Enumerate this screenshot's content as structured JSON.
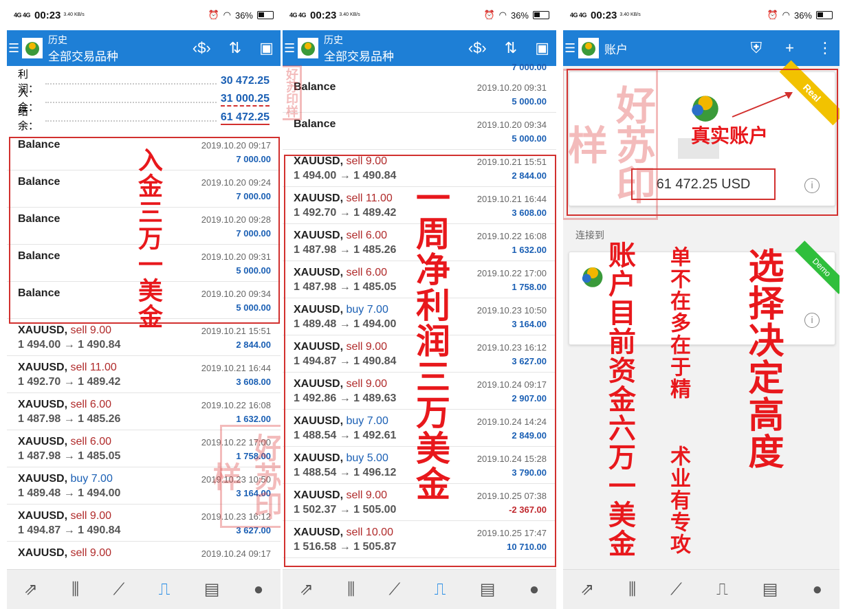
{
  "status": {
    "net": "4G 4G",
    "time": "00:23",
    "speed": "3.40\nKB/s",
    "battery": "36%"
  },
  "p1": {
    "title_small": "历史",
    "title_big": "全部交易品种",
    "summary": [
      {
        "label": "利润：",
        "value": "30 472.25"
      },
      {
        "label": "入金：",
        "value": "31 000.25"
      },
      {
        "label": "结余：",
        "value": "61 472.25"
      }
    ],
    "rows": [
      {
        "name": "Balance",
        "date": "2019.10.20 09:17",
        "amount": "7 000.00"
      },
      {
        "name": "Balance",
        "date": "2019.10.20 09:24",
        "amount": "7 000.00"
      },
      {
        "name": "Balance",
        "date": "2019.10.20 09:28",
        "amount": "7 000.00"
      },
      {
        "name": "Balance",
        "date": "2019.10.20 09:31",
        "amount": "5 000.00"
      },
      {
        "name": "Balance",
        "date": "2019.10.20 09:34",
        "amount": "5 000.00"
      },
      {
        "name": "XAUUSD,",
        "side": "sell 9.00",
        "sub": "1 494.00 → 1 490.84",
        "date": "2019.10.21 15:51",
        "amount": "2 844.00"
      },
      {
        "name": "XAUUSD,",
        "side": "sell 11.00",
        "sub": "1 492.70 → 1 489.42",
        "date": "2019.10.21 16:44",
        "amount": "3 608.00"
      },
      {
        "name": "XAUUSD,",
        "side": "sell 6.00",
        "sub": "1 487.98 → 1 485.26",
        "date": "2019.10.22 16:08",
        "amount": "1 632.00"
      },
      {
        "name": "XAUUSD,",
        "side": "sell 6.00",
        "sub": "1 487.98 → 1 485.05",
        "date": "2019.10.22 17:00",
        "amount": "1 758.00"
      },
      {
        "name": "XAUUSD,",
        "side": "buy 7.00",
        "sub": "1 489.48 → 1 494.00",
        "date": "2019.10.23 10:50",
        "amount": "3 164.00"
      },
      {
        "name": "XAUUSD,",
        "side": "sell 9.00",
        "sub": "1 494.87 → 1 490.84",
        "date": "2019.10.23 16:12",
        "amount": "3 627.00"
      },
      {
        "name": "XAUUSD,",
        "side": "sell 9.00",
        "sub": "",
        "date": "2019.10.24 09:17",
        "amount": ""
      }
    ],
    "callout": "入金三万一美金"
  },
  "p2": {
    "title_small": "历史",
    "title_big": "全部交易品种",
    "top_amount": "7 000.00",
    "rows": [
      {
        "name": "Balance",
        "date": "2019.10.20 09:31",
        "amount": "5 000.00"
      },
      {
        "name": "Balance",
        "date": "2019.10.20 09:34",
        "amount": "5 000.00"
      },
      {
        "name": "XAUUSD,",
        "side": "sell 9.00",
        "sub": "1 494.00 → 1 490.84",
        "date": "2019.10.21 15:51",
        "amount": "2 844.00"
      },
      {
        "name": "XAUUSD,",
        "side": "sell 11.00",
        "sub": "1 492.70 → 1 489.42",
        "date": "2019.10.21 16:44",
        "amount": "3 608.00"
      },
      {
        "name": "XAUUSD,",
        "side": "sell 6.00",
        "sub": "1 487.98 → 1 485.26",
        "date": "2019.10.22 16:08",
        "amount": "1 632.00"
      },
      {
        "name": "XAUUSD,",
        "side": "sell 6.00",
        "sub": "1 487.98 → 1 485.05",
        "date": "2019.10.22 17:00",
        "amount": "1 758.00"
      },
      {
        "name": "XAUUSD,",
        "side": "buy 7.00",
        "sub": "1 489.48 → 1 494.00",
        "date": "2019.10.23 10:50",
        "amount": "3 164.00"
      },
      {
        "name": "XAUUSD,",
        "side": "sell 9.00",
        "sub": "1 494.87 → 1 490.84",
        "date": "2019.10.23 16:12",
        "amount": "3 627.00"
      },
      {
        "name": "XAUUSD,",
        "side": "sell 9.00",
        "sub": "1 492.86 → 1 489.63",
        "date": "2019.10.24 09:17",
        "amount": "2 907.00"
      },
      {
        "name": "XAUUSD,",
        "side": "buy 7.00",
        "sub": "1 488.54 → 1 492.61",
        "date": "2019.10.24 14:24",
        "amount": "2 849.00"
      },
      {
        "name": "XAUUSD,",
        "side": "buy 5.00",
        "sub": "1 488.54 → 1 496.12",
        "date": "2019.10.24 15:28",
        "amount": "3 790.00"
      },
      {
        "name": "XAUUSD,",
        "side": "sell 9.00",
        "sub": "1 502.37 → 1 505.00",
        "date": "2019.10.25 07:38",
        "amount": "-2 367.00",
        "neg": true
      },
      {
        "name": "XAUUSD,",
        "side": "sell 10.00",
        "sub": "1 516.58 → 1 505.87",
        "date": "2019.10.25 17:47",
        "amount": "10 710.00"
      }
    ],
    "callout": "一周净利润三万美金"
  },
  "p3": {
    "title": "账户",
    "real_badge": "Real",
    "demo_badge": "Demo",
    "balance": "61 472.25 USD",
    "connect_label": "连接到",
    "real_label": "真实账户",
    "callout1": "账户目前资金六万一美金",
    "callout2a": "单不在多在于精",
    "callout2b": "术业有专攻",
    "callout3": "选择决定高度"
  },
  "watermark": "好苏印样"
}
